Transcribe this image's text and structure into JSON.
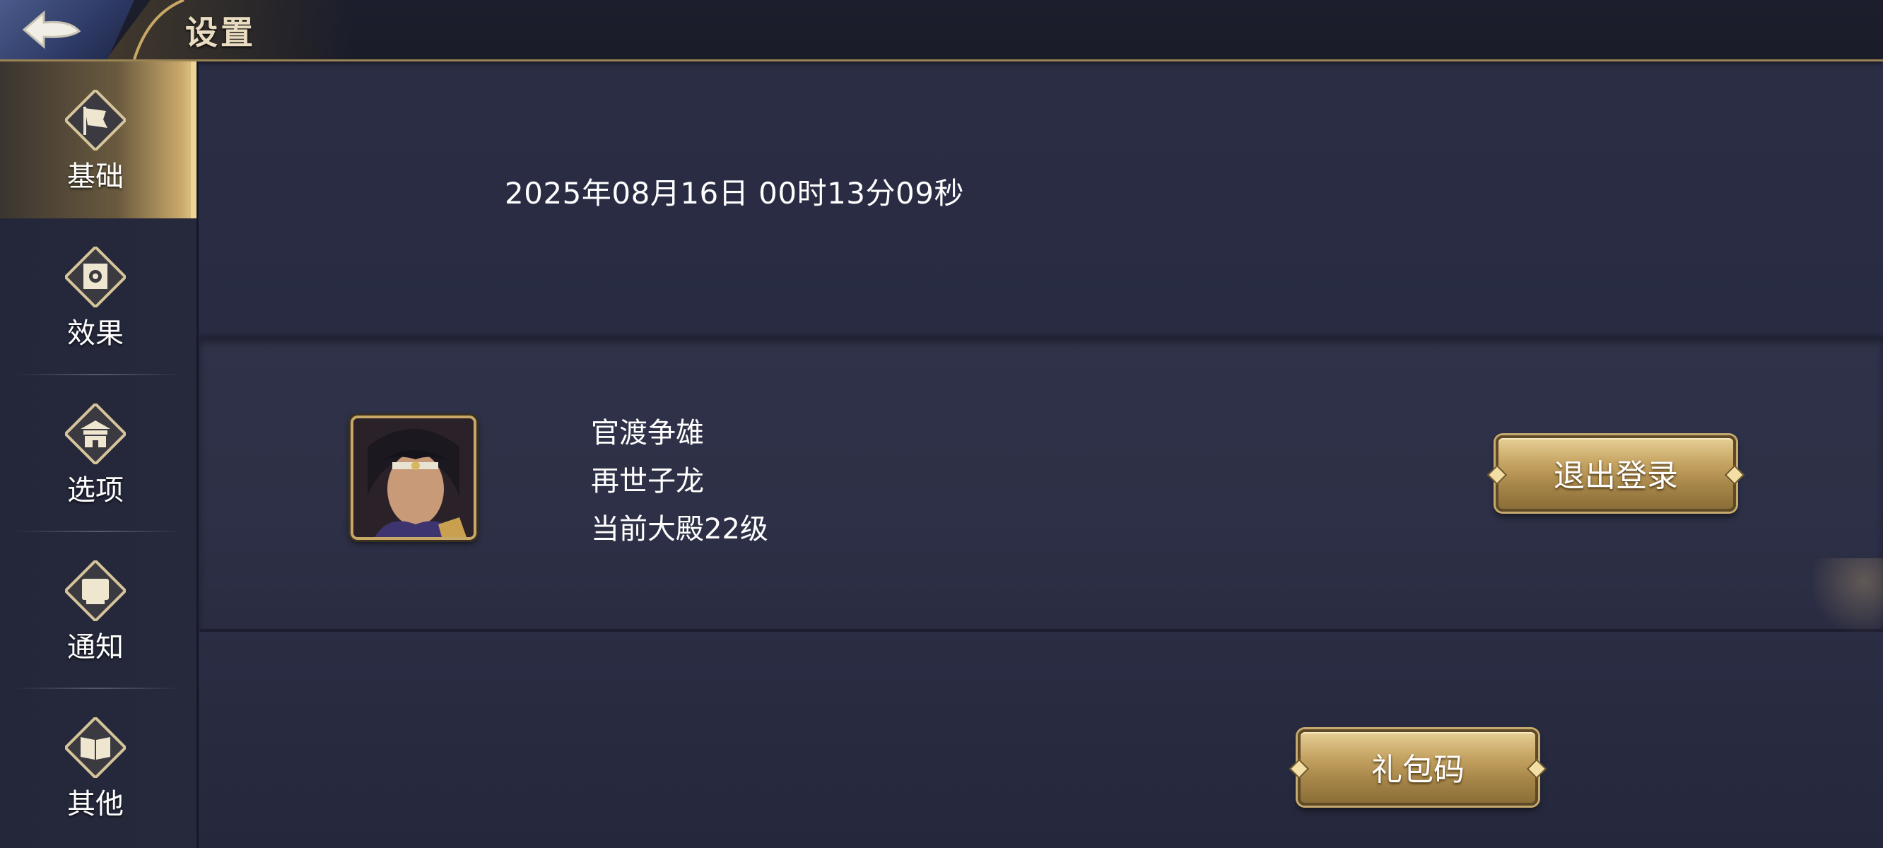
{
  "header": {
    "title": "设置"
  },
  "sidebar": {
    "items": [
      {
        "label": "基础",
        "icon": "flag-icon",
        "active": true
      },
      {
        "label": "效果",
        "icon": "eye-banner-icon",
        "active": false
      },
      {
        "label": "选项",
        "icon": "pagoda-icon",
        "active": false
      },
      {
        "label": "通知",
        "icon": "scroll-icon",
        "active": false
      },
      {
        "label": "其他",
        "icon": "book-icon",
        "active": false
      }
    ]
  },
  "main": {
    "datetime": "2025年08月16日 00时13分09秒",
    "account": {
      "server": "官渡争雄",
      "player_name": "再世子龙",
      "level_text": "当前大殿22级"
    },
    "logout_label": "退出登录",
    "gift_code_label": "礼包码"
  },
  "colors": {
    "accent_gold": "#c6a463",
    "background": "#2a2d43",
    "active_tab": "#e2c98a"
  }
}
